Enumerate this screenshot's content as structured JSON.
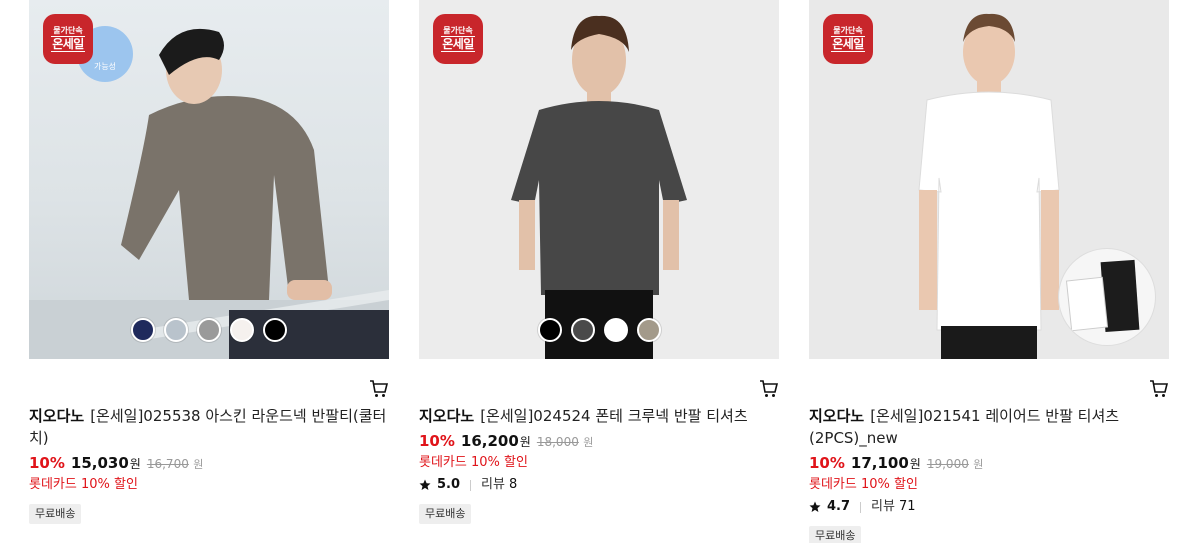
{
  "badge": {
    "small": "물가단속",
    "big": "온세일"
  },
  "products": [
    {
      "brand": "지오다노",
      "name": "[온세일]025538 아스킨 라운드넥 반팔티(쿨터치)",
      "discount": "10%",
      "price": "15,030",
      "won": "원",
      "original": "16,700",
      "card_promo": "롯데카드 10% 할인",
      "shipping": "무료배송",
      "sticker_text": "가능성",
      "swatch_colors": [
        "#1f2a5c",
        "#b9c3cc",
        "#9a9a9a",
        "#f5f1ee",
        "#000000"
      ]
    },
    {
      "brand": "지오다노",
      "name": "[온세일]024524 폰테 크루넥 반팔 티셔츠",
      "discount": "10%",
      "price": "16,200",
      "won": "원",
      "original": "18,000",
      "card_promo": "롯데카드 10% 할인",
      "rating": "5.0",
      "review_label": "리뷰",
      "review_count": "8",
      "shipping": "무료배송",
      "swatch_colors": [
        "#000000",
        "#4a4a4a",
        "#ffffff",
        "#a39a8a"
      ]
    },
    {
      "brand": "지오다노",
      "name": "[온세일]021541 레이어드 반팔 티셔츠(2PCS)_new",
      "discount": "10%",
      "price": "17,100",
      "won": "원",
      "original": "19,000",
      "card_promo": "롯데카드 10% 할인",
      "rating": "4.7",
      "review_label": "리뷰",
      "review_count": "71",
      "shipping": "무료배송"
    }
  ],
  "icons": {
    "cart": "cart-icon",
    "star": "star-icon"
  }
}
